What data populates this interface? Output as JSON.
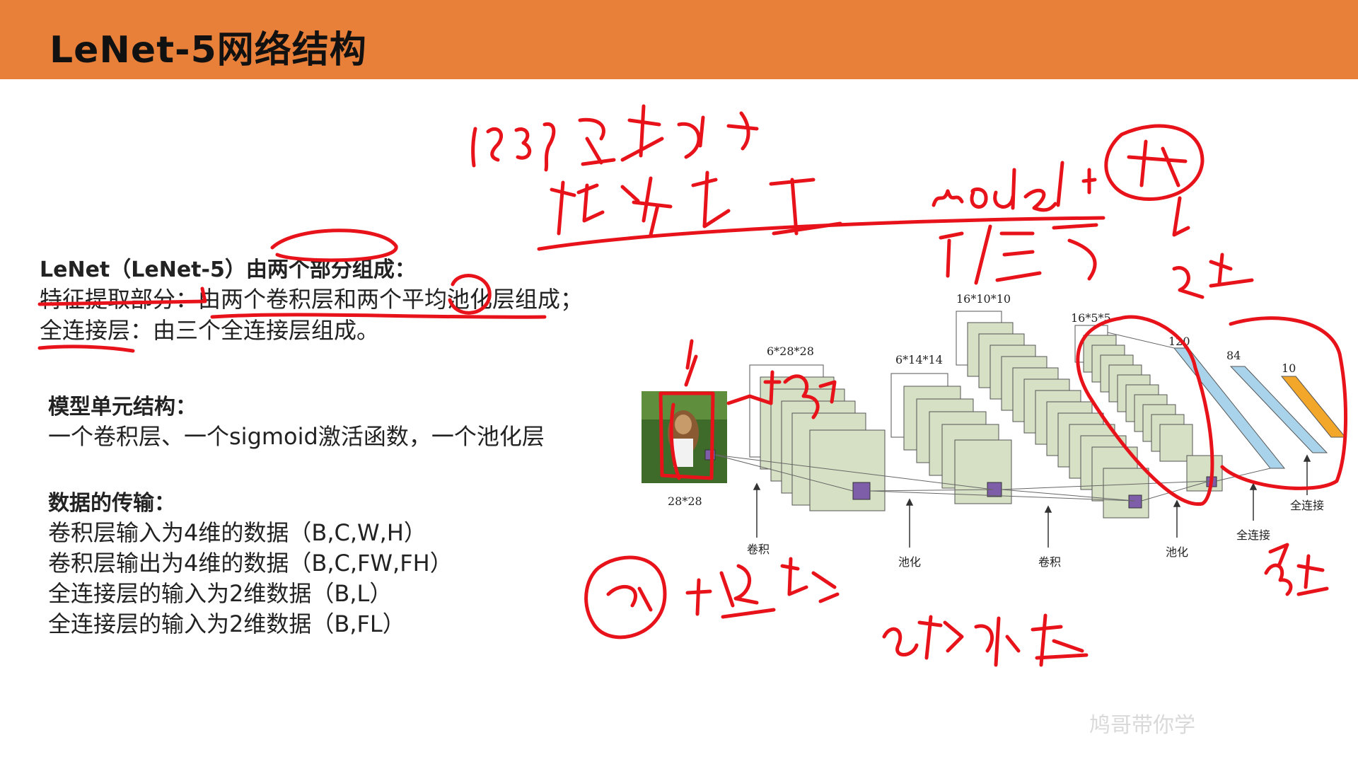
{
  "slide": {
    "title": "LeNet-5网络结构"
  },
  "overview": {
    "heading": "LeNet（LeNet-5）由两个部分组成：",
    "line1": "特征提取部分：由两个卷积层和两个平均池化层组成；",
    "line2": "全连接层：由三个全连接层组成。"
  },
  "unit": {
    "heading": "模型单元结构：",
    "line1": "一个卷积层、一个sigmoid激活函数，一个池化层"
  },
  "transfer": {
    "heading": "数据的传输：",
    "lines": [
      "卷积层输入为4维的数据（B,C,W,H）",
      "卷积层输出为4维的数据（B,C,FW,FH）",
      "全连接层的输入为2维数据（B,L）",
      "全连接层的输入为2维数据（B,FL）"
    ]
  },
  "diagram": {
    "input_size": "28*28",
    "conv1_size": "6*28*28",
    "pool1_size": "6*14*14",
    "conv2_size": "16*10*10",
    "pool2_size": "16*5*5",
    "fc_sizes": [
      "120",
      "84",
      "10"
    ],
    "labels": {
      "conv1": "卷积",
      "pool1": "池化",
      "conv2": "卷积",
      "pool2": "池化",
      "fc1": "全连接",
      "fc2": "全连接"
    },
    "colors": {
      "map_fill": "#d6e0c4",
      "kernel": "#7e5ea8",
      "fc_blue": "#a9d3ea",
      "fc_orange": "#f2a72a"
    }
  },
  "watermark": {
    "text": "鸠哥带你学"
  }
}
